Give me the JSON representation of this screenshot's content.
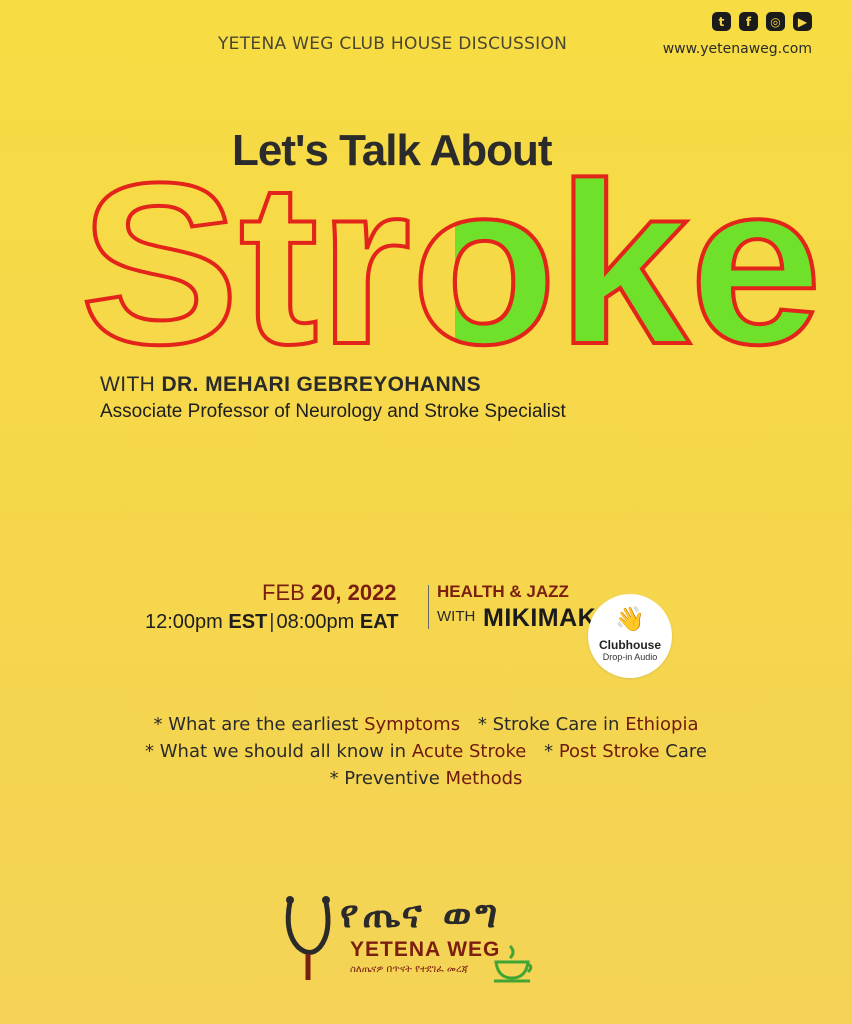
{
  "header": {
    "title": "YETENA WEG CLUB HOUSE DISCUSSION",
    "website": "www.yetenaweg.com",
    "social": [
      {
        "icon": "twitter-icon",
        "glyph": "t"
      },
      {
        "icon": "facebook-icon",
        "glyph": "f"
      },
      {
        "icon": "instagram-icon",
        "glyph": "◎"
      },
      {
        "icon": "youtube-icon",
        "glyph": "▶"
      }
    ]
  },
  "headline": {
    "lead": "Let's Talk About",
    "word": "Stroke",
    "outline_color": "#e3241b",
    "fill_color": "#6fe12a"
  },
  "speaker": {
    "prefix": "WITH ",
    "name": "DR. MEHARI GEBREYOHANNS",
    "title": "Associate Professor of Neurology and Stroke Specialist"
  },
  "event": {
    "month": "FEB ",
    "day_year": "20, 2022",
    "time_est": "12:00pm ",
    "est": "EST",
    "time_eat": "08:00pm ",
    "eat": "EAT",
    "segment": "HEALTH & JAZZ",
    "with": "WITH",
    "host": "MIKIMAK",
    "platform": "Clubhouse",
    "platform_sub": "Drop-in Audio"
  },
  "topics": {
    "r1a_pre": "* What are the earliest ",
    "r1a_hl": "Symptoms",
    "r1b_pre": "* Stroke Care in ",
    "r1b_hl": "Ethiopia",
    "r2a_pre": "* What we should all know in ",
    "r2a_hl": "Acute Stroke",
    "r2b_pre": "* ",
    "r2b_hl": "Post Stroke",
    "r2b_post": " Care",
    "r3_pre": "* Preventive ",
    "r3_hl": "Methods"
  },
  "logo": {
    "amharic": "የጤና ወግ",
    "brand": "YETENA WEG",
    "tagline": "ስለጤናዎ በጥናት የተደገፈ መረጃ"
  }
}
